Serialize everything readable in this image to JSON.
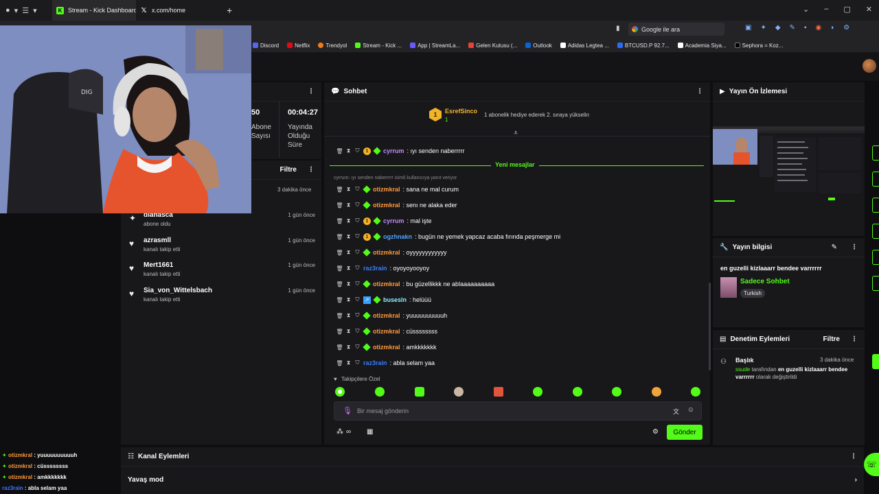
{
  "browser": {
    "tabs": [
      {
        "label": "Stream - Kick Dashboard",
        "favicon": "K"
      },
      {
        "label": "x.com/home",
        "favicon": "𝕏"
      }
    ],
    "search_placeholder": "Google ile ara",
    "bookmarks": [
      "Discord",
      "Netflix",
      "Trendyol",
      "Stream - Kick ...",
      "App | StreamLa...",
      "Gelen Kutusu (...",
      "Outlook",
      "Adidas Legtea ...",
      "BTCUSD.P 92.7...",
      "Academia Siya...",
      "Sephora = Koz..."
    ]
  },
  "stats": {
    "subs_value": "50",
    "subs_label_1": "Abone",
    "subs_label_2": "Sayısı",
    "uptime_value": "00:04:27",
    "uptime_label_1": "Yayında",
    "uptime_label_2": "Olduğu",
    "uptime_label_3": "Süre"
  },
  "activity": {
    "filter_label": "Filtre",
    "first_time": "3 dakika önce",
    "items": [
      {
        "name": "dianasca",
        "sub": "abone oldu",
        "time": "1 gün önce",
        "icon": "sparkle-icon"
      },
      {
        "name": "azrasmll",
        "sub": "kanalı takip etti",
        "time": "1 gün önce",
        "icon": "heart-icon"
      },
      {
        "name": "Mert1661",
        "sub": "kanalı takip etti",
        "time": "1 gün önce",
        "icon": "heart-icon"
      },
      {
        "name": "Sia_von_Wittelsbach",
        "sub": "kanalı takip etti",
        "time": "1 gün önce",
        "icon": "heart-icon"
      }
    ]
  },
  "chat": {
    "title": "Sohbet",
    "pinned_user": "EsrefSinco",
    "pinned_count": "1",
    "pinned_text": "1 abonelik hediye ederek 2. sıraya yükselin",
    "new_messages_label": "Yeni mesajlar",
    "reply_hint": "cyrrum: ıyı senden naberrrrr isimli kullanıcıya yanıt veriyor",
    "followers_only": "Takipçilere Özel",
    "input_placeholder": "Bir mesaj gönderin",
    "send_label": "Gönder",
    "messages": [
      {
        "user": "cyrrum",
        "text": ": ıyı senden naberrrrr",
        "color": "#c28bff",
        "sub": true,
        "og": true,
        "vip": false
      },
      {
        "user": "otizmkral",
        "text": ": sana ne mal curum",
        "color": "#ff9a3c",
        "sub": false,
        "og": true,
        "vip": false
      },
      {
        "user": "otizmkral",
        "text": ": senı ne alaka eder",
        "color": "#ff9a3c",
        "sub": false,
        "og": true,
        "vip": false
      },
      {
        "user": "cyrrum",
        "text": ": mal işte",
        "color": "#c28bff",
        "sub": true,
        "og": true,
        "vip": false
      },
      {
        "user": "ogzhnakn",
        "text": ": bugün ne yemek yapcaz acaba fırında peşmerge mi",
        "color": "#4fa3ff",
        "sub": true,
        "og": true,
        "vip": false
      },
      {
        "user": "otizmkral",
        "text": ": oyyyyyyyyyyyy",
        "color": "#ff9a3c",
        "sub": false,
        "og": true,
        "vip": false
      },
      {
        "user": "raz3rain",
        "text": ": oyoyoyooyoy",
        "color": "#3a7bff",
        "sub": false,
        "og": false,
        "vip": false
      },
      {
        "user": "otizmkral",
        "text": ": bu güzellikkk ne ablaaaaaaaaaa",
        "color": "#ff9a3c",
        "sub": false,
        "og": true,
        "vip": false
      },
      {
        "user": "busesln",
        "text": ": helüüü",
        "color": "#8ff0ff",
        "sub": false,
        "og": true,
        "vip": true
      },
      {
        "user": "otizmkral",
        "text": ": yuuuuuuuuuuh",
        "color": "#ff9a3c",
        "sub": false,
        "og": true,
        "vip": false
      },
      {
        "user": "otizmkral",
        "text": ": cüssssssss",
        "color": "#ff9a3c",
        "sub": false,
        "og": true,
        "vip": false
      },
      {
        "user": "otizmkral",
        "text": ": amkkkkkkk",
        "color": "#ff9a3c",
        "sub": false,
        "og": true,
        "vip": false
      },
      {
        "user": "raz3rain",
        "text": ": abla selam yaa",
        "color": "#3a7bff",
        "sub": false,
        "og": false,
        "vip": false
      }
    ]
  },
  "preview": {
    "title": "Yayın Ön İzlemesi"
  },
  "stream_info": {
    "title": "Yayın bilgisi",
    "stream_title": "en guzelli kizlaaarr bendee varrrrrr",
    "category": "Sadece Sohbet",
    "language": "Turkish"
  },
  "mod_actions": {
    "title": "Denetim Eylemleri",
    "filter_label": "Filtre",
    "item_title": "Başlık",
    "item_time": "3 dakika önce",
    "item_user": "ssude",
    "item_middle": " tarafından ",
    "item_value": "en guzelli kizlaaarr bendee varrrrrr",
    "item_suffix": " olarak değiştirildi"
  },
  "channel_actions": {
    "title": "Kanal Eylemleri",
    "slow_mode": "Yavaş mod"
  },
  "overlay_chat": [
    {
      "user": "otizmkral",
      "text": " : yuuuuuuuuuuh",
      "color": "#ff9a3c"
    },
    {
      "user": "otizmkral",
      "text": " : cüssssssss",
      "color": "#ff9a3c"
    },
    {
      "user": "otizmkral",
      "text": " : amkkkkkkk",
      "color": "#ff9a3c"
    },
    {
      "user": "raz3rain",
      "text": " : abla selam yaa",
      "color": "#3a7bff"
    }
  ],
  "colors": {
    "accent": "#53fc18",
    "panel": "#18181b",
    "bg": "#0e0e10"
  }
}
